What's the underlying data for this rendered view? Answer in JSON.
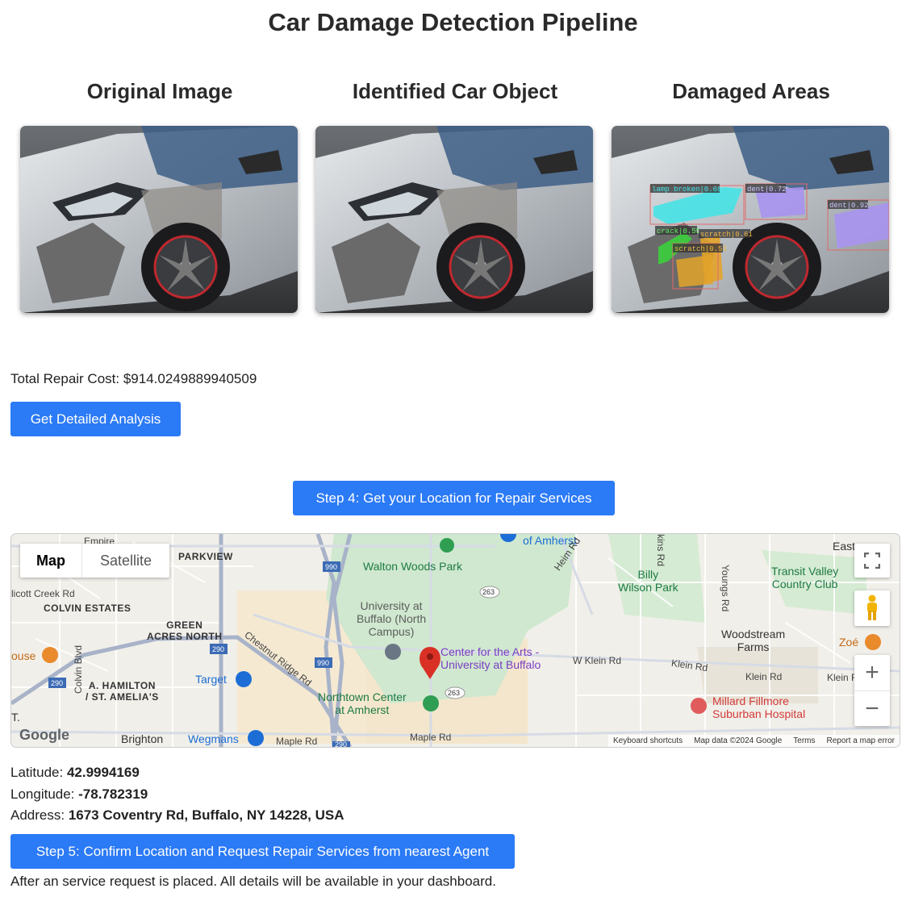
{
  "page": {
    "title": "Car Damage Detection Pipeline"
  },
  "panels": [
    {
      "title": "Original Image"
    },
    {
      "title": "Identified Car Object"
    },
    {
      "title": "Damaged Areas"
    }
  ],
  "detections": [
    {
      "label": "lamp broken|0.68",
      "color": "#3ee4e8"
    },
    {
      "label": "dent|0.72",
      "color": "#a793f0"
    },
    {
      "label": "dent|0.92",
      "color": "#a793f0"
    },
    {
      "label": "crack|0.55",
      "color": "#3ccf3c"
    },
    {
      "label": "scratch|0.61",
      "color": "#e3a32a"
    },
    {
      "label": "scratch|0.53",
      "color": "#e3a32a"
    }
  ],
  "repair": {
    "cost_text": "Total Repair Cost: $914.0249889940509",
    "analysis_button": "Get Detailed Analysis"
  },
  "step4": {
    "button": "Step 4: Get your Location for Repair Services"
  },
  "map": {
    "type_map": "Map",
    "type_satellite": "Satellite",
    "labels": {
      "parkview": "PARKVIEW",
      "colvin_estates": "COLVIN ESTATES",
      "green_acres": "GREEN\nACRES NORTH",
      "hamilton": "A. HAMILTON\n/ ST. AMELIA'S",
      "walton": "Walton Woods Park",
      "ub_north": "University at\nBuffalo (North\nCampus)",
      "center_arts": "Center for the Arts -\nUniversity at Buffalo",
      "northtown": "Northtown Center\nat Amherst",
      "billy_wilson": "Billy\nWilson Park",
      "transit_valley": "Transit Valley\nCountry Club",
      "woodstream": "Woodstream\nFarms",
      "millard": "Millard Fillmore\nSuburban Hospital",
      "target": "Target",
      "wegmans": "Wegmans",
      "brighton": "Brighton",
      "amherst_top": "of Amherst",
      "zoe": "Zoé",
      "house": "ouse",
      "east": "East",
      "chestnut": "Chestnut Ridge Rd",
      "heim": "Heim Rd",
      "w_klein": "W Klein Rd",
      "klein1": "Klein Rd",
      "klein2": "Klein Rd",
      "klein3": "Klein Rd",
      "maple1": "Maple Rd",
      "maple2": "Maple Rd",
      "youngs": "Youngs Rd",
      "hopkins": "kins Rd",
      "ellicott": "licott Creek Rd",
      "colvin_blvd": "Colvin Blvd",
      "emp": "Empire",
      "t_label": "T."
    },
    "shields": [
      "990",
      "290",
      "290",
      "990",
      "263",
      "263",
      "290"
    ],
    "logo": "Google",
    "attribution": [
      "Keyboard shortcuts",
      "Map data ©2024 Google",
      "Terms",
      "Report a map error"
    ],
    "zoom_in": "+",
    "zoom_out": "−"
  },
  "location": {
    "latitude_label": "Latitude: ",
    "latitude": "42.9994169",
    "longitude_label": "Longitude: ",
    "longitude": "-78.782319",
    "address_label": "Address: ",
    "address": "1673 Coventry Rd, Buffalo, NY 14228, USA"
  },
  "step5": {
    "button": "Step 5: Confirm Location and Request Repair Services from nearest Agent",
    "note": "After an service request is placed. All details will be available in your dashboard."
  },
  "colors": {
    "accent": "#2b7af6",
    "pin": "#d93025"
  }
}
